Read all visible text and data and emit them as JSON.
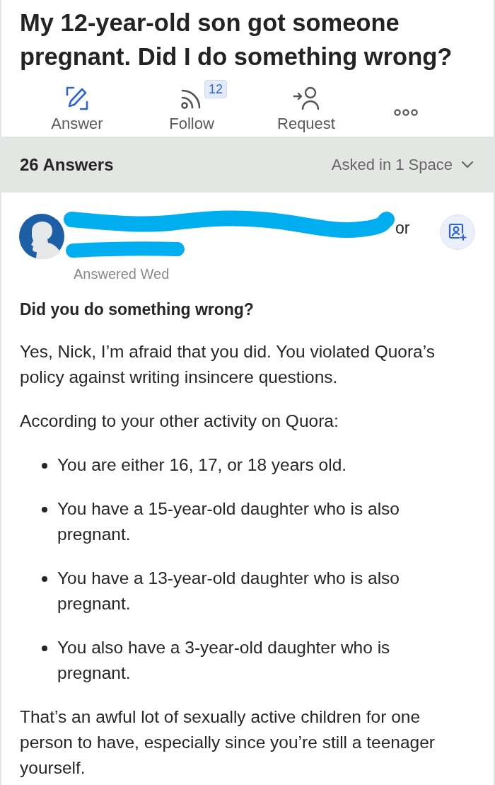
{
  "question": {
    "title": "My 12-year-old son got someone pregnant. Did I do something wrong?"
  },
  "actions": [
    {
      "kind": "answer",
      "label": "Answer"
    },
    {
      "kind": "follow",
      "label": "Follow",
      "badge": "12"
    },
    {
      "kind": "request",
      "label": "Request"
    },
    {
      "kind": "more"
    }
  ],
  "answers_bar": {
    "count": "26 Answers",
    "spaces": "Asked in 1 Space"
  },
  "answer": {
    "author": {
      "name_fragment": "or"
    },
    "meta": "Answered Wed",
    "blocks": [
      {
        "kind": "heading",
        "text": "Did you do something wrong?"
      },
      {
        "kind": "paragraph",
        "text": "Yes, Nick, I’m afraid that you did. You violated Quora’s policy against writing insincere questions."
      },
      {
        "kind": "paragraph",
        "text": "According to your other activity on Quora:"
      },
      {
        "kind": "bullet",
        "text": "You are either 16, 17, or 18 years old."
      },
      {
        "kind": "bullet",
        "text": "You have a 15-year-old daughter who is also pregnant."
      },
      {
        "kind": "bullet",
        "text": "You have a 13-year-old daughter who is also pregnant."
      },
      {
        "kind": "bullet",
        "text": "You also have a 3-year-old daughter who is pregnant."
      },
      {
        "kind": "paragraph",
        "text": "That’s an awful lot of sexually active children for one person to have, especially since you’re still a teenager yourself."
      }
    ]
  }
}
